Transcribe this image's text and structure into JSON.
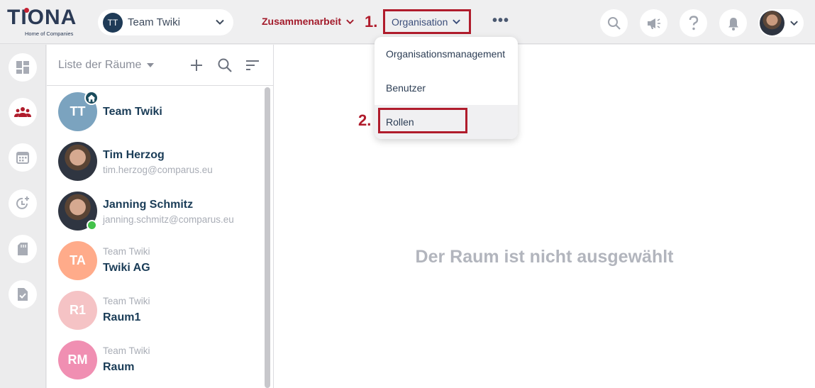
{
  "app": {
    "logo_text": "TIONA",
    "logo_sub": "Home of Companies"
  },
  "header": {
    "team_select": {
      "avatar": "TT",
      "label": "Team Twiki"
    },
    "nav_zusammenarbeit": "Zusammenarbeit",
    "nav_organisation": "Organisation",
    "step1": "1.",
    "step2": "2.",
    "more": "•••",
    "icons": [
      "search-icon",
      "megaphone-icon",
      "help-icon",
      "bell-icon",
      "avatar"
    ]
  },
  "dropdown": {
    "items": [
      "Organisationsmanagement",
      "Benutzer",
      "Rollen"
    ]
  },
  "rail": {
    "icons": [
      "dashboard-icon",
      "team-icon",
      "calendar-icon",
      "clock-add-icon",
      "card-icon",
      "file-check-icon"
    ]
  },
  "room_list": {
    "title": "Liste der Räume",
    "rooms": [
      {
        "avatar": "TT",
        "name": "Team Twiki",
        "sub": "",
        "color": "#7ba3bf"
      },
      {
        "avatar": "",
        "name": "Tim Herzog",
        "sub": "tim.herzog@comparus.eu",
        "color": "#555"
      },
      {
        "avatar": "",
        "name": "Janning Schmitz",
        "sub": "janning.schmitz@comparus.eu",
        "color": "#555"
      },
      {
        "avatar": "TA",
        "name": "Twiki AG",
        "sub": "Team Twiki",
        "color": "#ffab8a"
      },
      {
        "avatar": "R1",
        "name": "Raum1",
        "sub": "Team Twiki",
        "color": "#f5c3c5"
      },
      {
        "avatar": "RM",
        "name": "Raum",
        "sub": "Team Twiki",
        "color": "#f08fb2"
      }
    ]
  },
  "main": {
    "empty_message": "Der Raum ist nicht ausgewählt"
  },
  "colors": {
    "accent": "#b01c2c",
    "navy": "#1a3c57",
    "online": "#43c24a"
  }
}
